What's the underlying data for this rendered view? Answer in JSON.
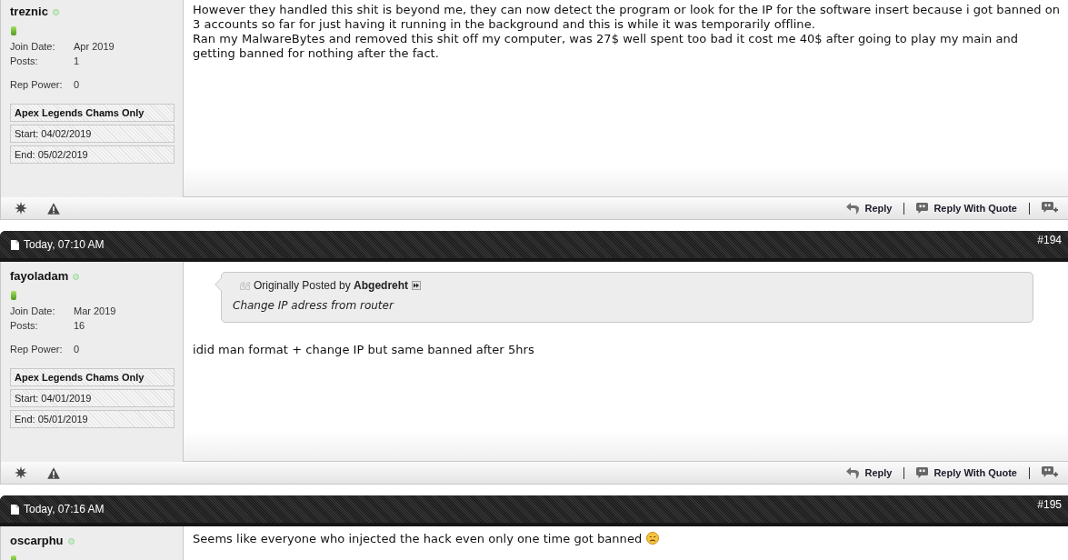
{
  "posts": [
    {
      "author": {
        "name": "treznic",
        "online": true,
        "details": [
          {
            "label": "Join Date:",
            "value": "Apr 2019"
          },
          {
            "label": "Posts:",
            "value": "1"
          },
          {
            "label": "Rep Power:",
            "value": "0"
          }
        ],
        "subscription": [
          {
            "text": "Apex Legends Chams Only",
            "kind": "title"
          },
          {
            "text": "Start: 04/02/2019",
            "kind": "plain"
          },
          {
            "text": "End: 05/02/2019",
            "kind": "plain"
          }
        ]
      },
      "body": {
        "paragraphs": [
          {
            "text": "However they handled this shit is beyond me, they can now detect the program or look for the IP for the software insert because i got banned on 3 accounts so far for just having it running in the background and this is while it was temporarily offline."
          },
          {
            "text": "Ran my MalwareBytes and removed this shit off my computer, was 27$ well spent too bad it cost me 40$ after going to play my main and getting banned for nothing after the fact."
          }
        ]
      },
      "actions": [
        {
          "kind": "reply",
          "label": "Reply"
        },
        {
          "kind": "quote",
          "label": "Reply With Quote"
        }
      ]
    },
    {
      "header": {
        "date": "Today, 07:10 AM",
        "number": "#194"
      },
      "author": {
        "name": "fayoladam",
        "online": true,
        "details": [
          {
            "label": "Join Date:",
            "value": "Mar 2019"
          },
          {
            "label": "Posts:",
            "value": "16"
          },
          {
            "label": "Rep Power:",
            "value": "0"
          }
        ],
        "subscription": [
          {
            "text": "Apex Legends Chams Only",
            "kind": "title"
          },
          {
            "text": "Start: 04/01/2019",
            "kind": "plain"
          },
          {
            "text": "End: 05/01/2019",
            "kind": "plain"
          }
        ]
      },
      "body": {
        "quote": {
          "attribution": "Originally Posted by **Abgedreht**",
          "text": "Change IP adress from router"
        },
        "paragraphs": [
          {
            "text": "idid man format + change IP but same banned after 5hrs"
          }
        ]
      },
      "actions": [
        {
          "kind": "reply",
          "label": "Reply"
        },
        {
          "kind": "quote",
          "label": "Reply With Quote"
        }
      ]
    },
    {
      "header": {
        "date": "Today, 07:16 AM",
        "number": "#195"
      },
      "author": {
        "name": "oscarphu",
        "online": true
      },
      "body": {
        "paragraphs": [
          {
            "text": "Seems like everyone who injected the hack even only one time got banned",
            "smiley": {
              "kind": "frown"
            }
          }
        ]
      }
    }
  ]
}
